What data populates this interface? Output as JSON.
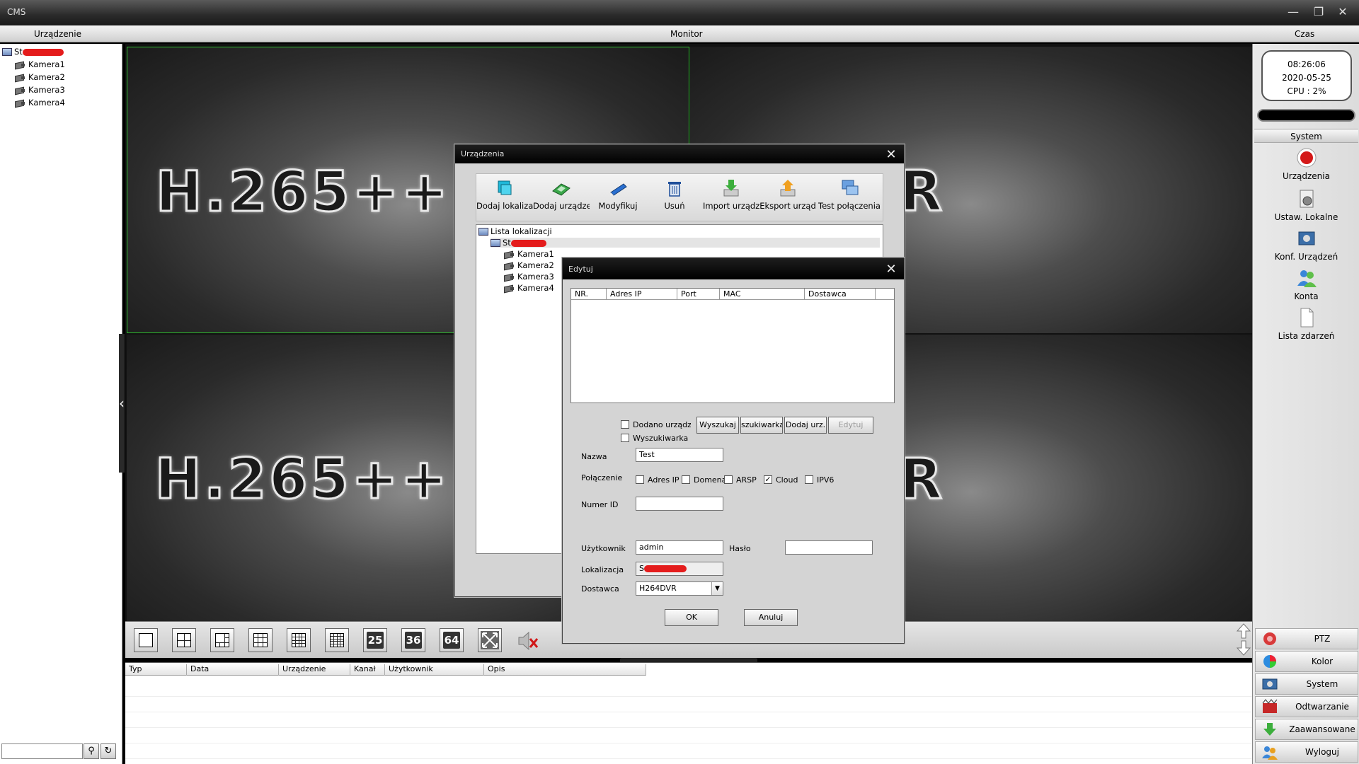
{
  "window": {
    "title": "CMS"
  },
  "header": {
    "left": "Urządzenie",
    "center": "Monitor",
    "right": "Czas"
  },
  "device_tree": {
    "root_label": "St",
    "cameras": [
      "Kamera1",
      "Kamera2",
      "Kamera3",
      "Kamera4"
    ]
  },
  "monitor": {
    "tile_text": "H.265++ XVR",
    "tile_text_right": "5++ XVR",
    "tile_text_left": "H.265++"
  },
  "clock": {
    "time": "08:26:06",
    "date": "2020-05-25",
    "cpu": "CPU : 2%"
  },
  "right_panel": {
    "section": "System",
    "items": [
      "Urządzenia",
      "Ustaw. Lokalne",
      "Konf. Urządzeń",
      "Konta",
      "Lista zdarzeń"
    ],
    "bottom": [
      "PTZ",
      "Kolor",
      "System",
      "Odtwarzanie",
      "Zaawansowane",
      "Wyloguj"
    ]
  },
  "toolbar": {
    "num_buttons": [
      "25",
      "36",
      "64"
    ]
  },
  "log_table": {
    "columns": [
      "Typ",
      "Data",
      "Urządzenie",
      "Kanał",
      "Użytkownik",
      "Opis"
    ]
  },
  "devices_dialog": {
    "title": "Urządzenia",
    "tools": [
      "Dodaj lokalizac",
      "Dodaj urządzen",
      "Modyfikuj",
      "Usuń",
      "Import urządze",
      "Eksport urząd",
      "Test połączenia"
    ],
    "tree_root": "Lista lokalizacji",
    "tree_location": "St",
    "cameras": [
      "Kamera1",
      "Kamera2",
      "Kamera3",
      "Kamera4"
    ]
  },
  "edit_dialog": {
    "title": "Edytuj",
    "columns": [
      "NR.",
      "Adres IP",
      "Port",
      "MAC",
      "Dostawca"
    ],
    "added_devices_label": "Dodano urządzeni",
    "search_label": "Wyszukiwarka (",
    "buttons": [
      "Wyszukaj",
      "szukiwarka I",
      "Dodaj urz.",
      "Edytuj"
    ],
    "name_label": "Nazwa",
    "name_value": "Test",
    "connection_label": "Połączenie",
    "connection_options": [
      "Adres IP",
      "Domena",
      "ARSP",
      "Cloud",
      "IPV6"
    ],
    "id_label": "Numer ID",
    "id_value": "",
    "user_label": "Użytkownik",
    "user_value": "admin",
    "password_label": "Hasło",
    "location_label": "Lokalizacja",
    "location_value": "S",
    "vendor_label": "Dostawca",
    "vendor_value": "H264DVR",
    "ok": "OK",
    "cancel": "Anuluj"
  }
}
